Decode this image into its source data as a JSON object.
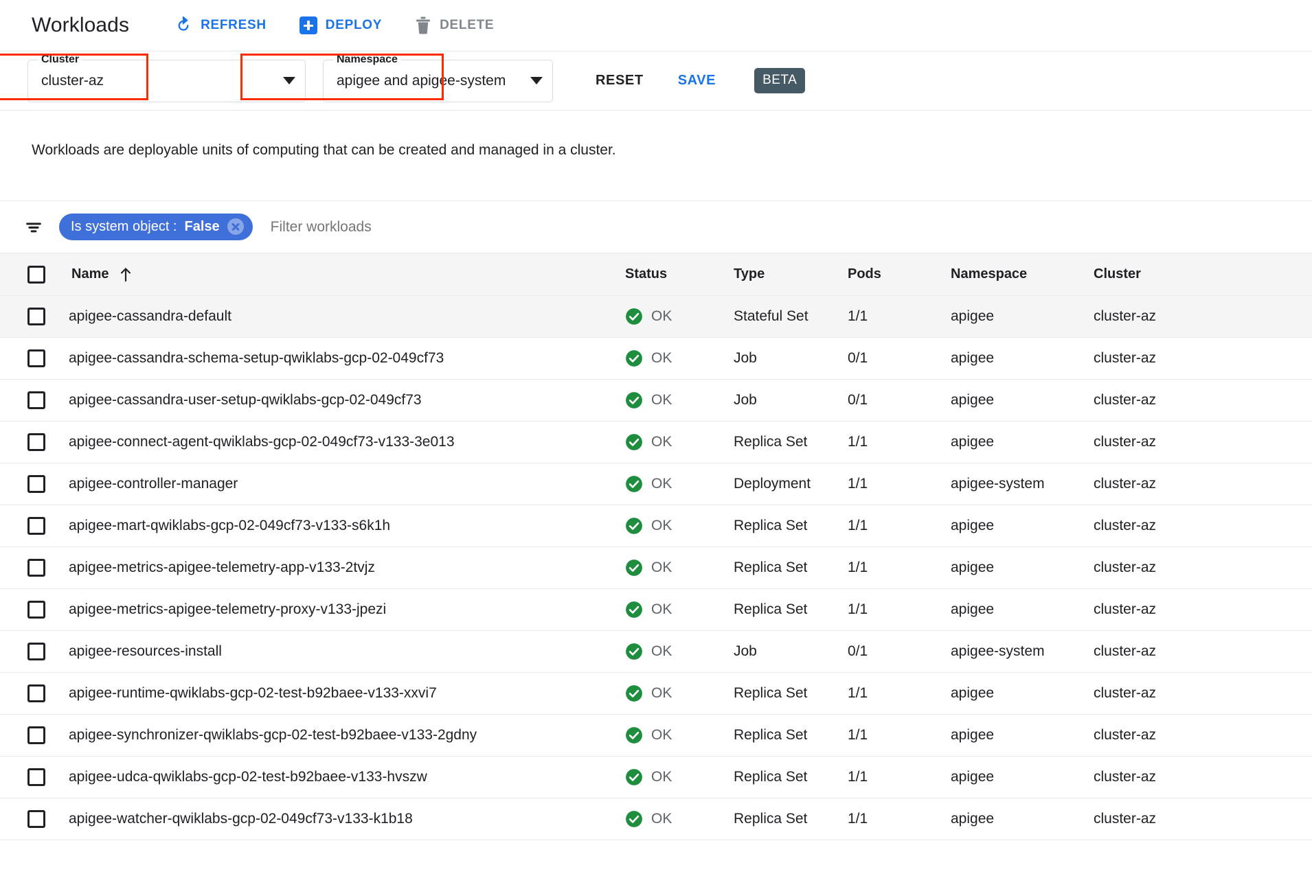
{
  "header": {
    "title": "Workloads",
    "actions": [
      {
        "id": "refresh",
        "label": "REFRESH",
        "icon": "refresh-icon",
        "state": "enabled"
      },
      {
        "id": "deploy",
        "label": "DEPLOY",
        "icon": "plus-icon",
        "state": "enabled"
      },
      {
        "id": "delete",
        "label": "DELETE",
        "icon": "trash-icon",
        "state": "disabled"
      }
    ]
  },
  "selectors": {
    "cluster": {
      "legend": "Cluster",
      "value": "cluster-az"
    },
    "namespace": {
      "legend": "Namespace",
      "value": "apigee and apigee-system"
    },
    "reset_label": "RESET",
    "save_label": "SAVE",
    "beta_label": "BETA"
  },
  "description": "Workloads are deployable units of computing that can be created and managed in a cluster.",
  "filter": {
    "icon": "filter-list-icon",
    "chip": {
      "key": "Is system object :",
      "value": "False",
      "remove_icon": "close-icon"
    },
    "placeholder": "Filter workloads"
  },
  "table": {
    "columns": [
      "Name",
      "Status",
      "Type",
      "Pods",
      "Namespace",
      "Cluster"
    ],
    "sort": {
      "column": "Name",
      "direction": "ascending",
      "icon": "arrow-up-icon"
    },
    "rows": [
      {
        "name": "apigee-cassandra-default",
        "status": "OK",
        "type": "Stateful Set",
        "pods": "1/1",
        "namespace": "apigee",
        "cluster": "cluster-az"
      },
      {
        "name": "apigee-cassandra-schema-setup-qwiklabs-gcp-02-049cf73",
        "status": "OK",
        "type": "Job",
        "pods": "0/1",
        "namespace": "apigee",
        "cluster": "cluster-az"
      },
      {
        "name": "apigee-cassandra-user-setup-qwiklabs-gcp-02-049cf73",
        "status": "OK",
        "type": "Job",
        "pods": "0/1",
        "namespace": "apigee",
        "cluster": "cluster-az"
      },
      {
        "name": "apigee-connect-agent-qwiklabs-gcp-02-049cf73-v133-3e013",
        "status": "OK",
        "type": "Replica Set",
        "pods": "1/1",
        "namespace": "apigee",
        "cluster": "cluster-az"
      },
      {
        "name": "apigee-controller-manager",
        "status": "OK",
        "type": "Deployment",
        "pods": "1/1",
        "namespace": "apigee-system",
        "cluster": "cluster-az"
      },
      {
        "name": "apigee-mart-qwiklabs-gcp-02-049cf73-v133-s6k1h",
        "status": "OK",
        "type": "Replica Set",
        "pods": "1/1",
        "namespace": "apigee",
        "cluster": "cluster-az"
      },
      {
        "name": "apigee-metrics-apigee-telemetry-app-v133-2tvjz",
        "status": "OK",
        "type": "Replica Set",
        "pods": "1/1",
        "namespace": "apigee",
        "cluster": "cluster-az"
      },
      {
        "name": "apigee-metrics-apigee-telemetry-proxy-v133-jpezi",
        "status": "OK",
        "type": "Replica Set",
        "pods": "1/1",
        "namespace": "apigee",
        "cluster": "cluster-az"
      },
      {
        "name": "apigee-resources-install",
        "status": "OK",
        "type": "Job",
        "pods": "0/1",
        "namespace": "apigee-system",
        "cluster": "cluster-az"
      },
      {
        "name": "apigee-runtime-qwiklabs-gcp-02-test-b92baee-v133-xxvi7",
        "status": "OK",
        "type": "Replica Set",
        "pods": "1/1",
        "namespace": "apigee",
        "cluster": "cluster-az"
      },
      {
        "name": "apigee-synchronizer-qwiklabs-gcp-02-test-b92baee-v133-2gdny",
        "status": "OK",
        "type": "Replica Set",
        "pods": "1/1",
        "namespace": "apigee",
        "cluster": "cluster-az"
      },
      {
        "name": "apigee-udca-qwiklabs-gcp-02-test-b92baee-v133-hvszw",
        "status": "OK",
        "type": "Replica Set",
        "pods": "1/1",
        "namespace": "apigee",
        "cluster": "cluster-az"
      },
      {
        "name": "apigee-watcher-qwiklabs-gcp-02-049cf73-v133-k1b18",
        "status": "OK",
        "type": "Replica Set",
        "pods": "1/1",
        "namespace": "apigee",
        "cluster": "cluster-az"
      }
    ]
  },
  "colors": {
    "accent_blue": "#1a73e8",
    "chip_blue": "#3f6fd8",
    "status_green": "#1e8e3e",
    "beta_slate": "#455a64",
    "annotation_red": "#ff2a00"
  }
}
